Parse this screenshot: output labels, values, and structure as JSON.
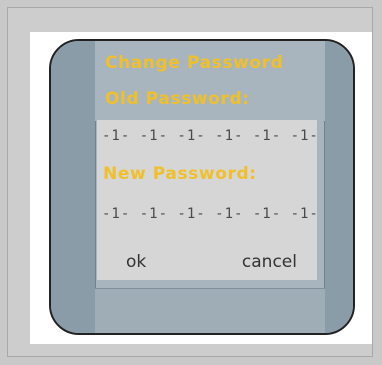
{
  "dialog": {
    "title": "Change Password",
    "old_password_label": "Old Password:",
    "old_password_value": "-1- -1- -1- -1- -1- -1-",
    "new_password_label": "New Password:",
    "new_password_value": "-1- -1- -1- -1- -1- -1-",
    "ok_label": "ok",
    "cancel_label": "cancel"
  },
  "colors": {
    "accent_text": "#f0c02b",
    "device_body": "#a8b5be",
    "device_sides": "#8a9ca7",
    "content_panel": "#d6d6d6"
  }
}
